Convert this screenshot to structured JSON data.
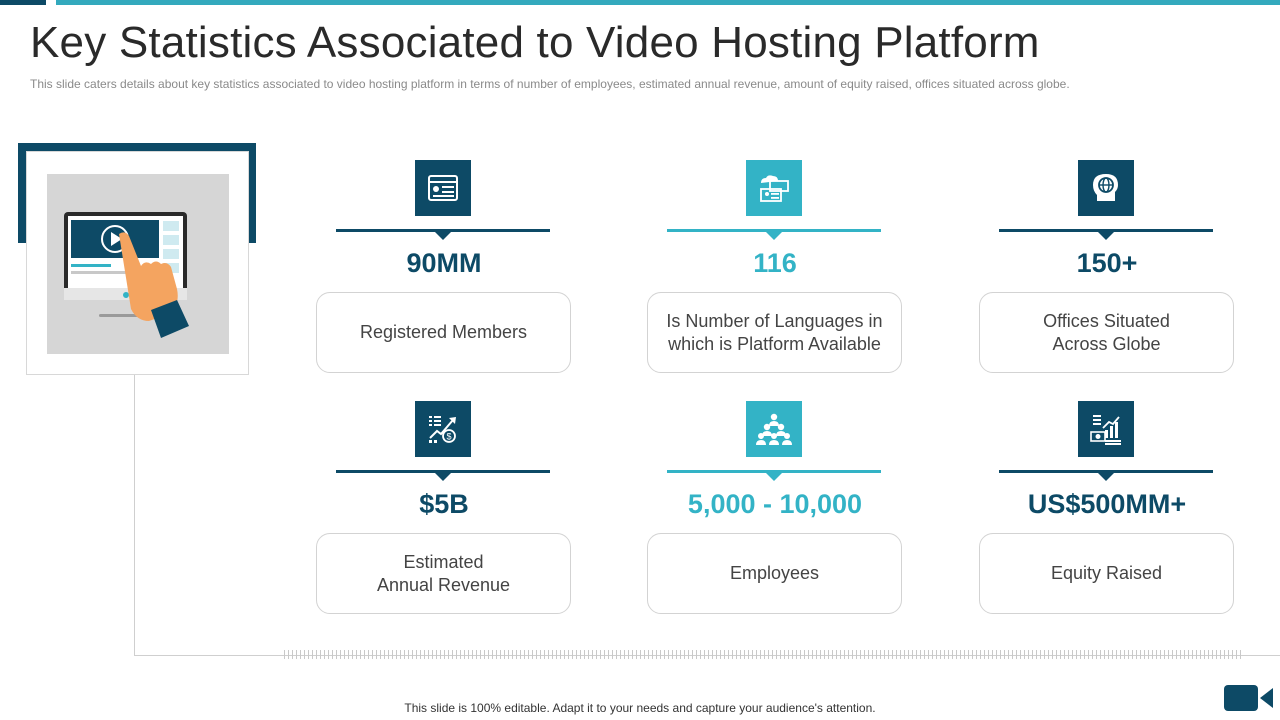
{
  "slide": {
    "title": "Key Statistics Associated to Video Hosting Platform",
    "subtitle": "This slide caters details about key statistics associated to video  hosting platform in terms of number  of employees, estimated annual revenue,  amount of equity raised, offices situated across globe.",
    "footer": "This slide is 100% editable. Adapt it to your needs and capture your audience's attention."
  },
  "colors": {
    "dark": "#0d4a66",
    "teal": "#33b3c6",
    "accent_bar": "#33a9bd"
  },
  "stats": [
    {
      "value": "90MM",
      "label": "Registered Members",
      "icon": "website-icon",
      "theme": "dark"
    },
    {
      "value": "116",
      "label": "Is Number of Languages in\nwhich is Platform Available",
      "icon": "profile-cards-icon",
      "theme": "teal"
    },
    {
      "value": "150+",
      "label": "Offices Situated\nAcross Globe",
      "icon": "globe-head-icon",
      "theme": "dark"
    },
    {
      "value": "$5B",
      "label": "Estimated\nAnnual Revenue",
      "icon": "revenue-growth-icon",
      "theme": "dark"
    },
    {
      "value": "5,000 - 10,000",
      "label": "Employees",
      "icon": "team-icon",
      "theme": "teal"
    },
    {
      "value": "US$500MM+",
      "label": "Equity Raised",
      "icon": "money-growth-icon",
      "theme": "dark"
    }
  ]
}
